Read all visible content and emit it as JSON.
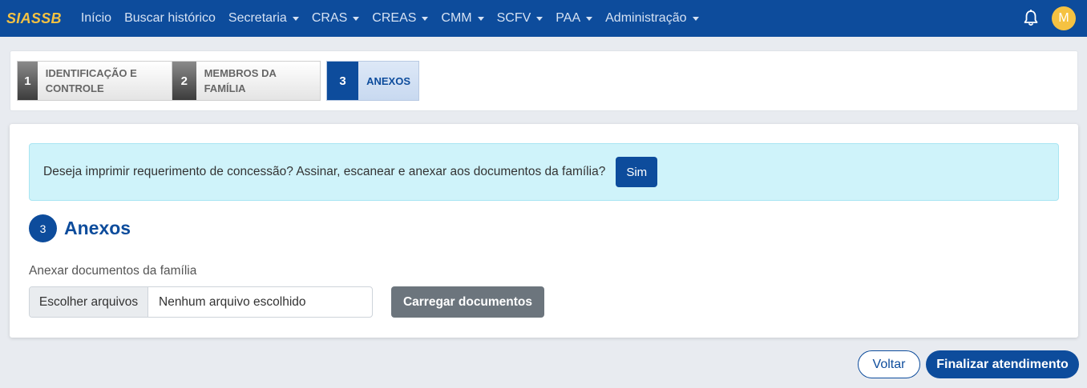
{
  "navbar": {
    "brand": "SIASSB",
    "items": [
      {
        "label": "Início",
        "dropdown": false
      },
      {
        "label": "Buscar histórico",
        "dropdown": false
      },
      {
        "label": "Secretaria",
        "dropdown": true
      },
      {
        "label": "CRAS",
        "dropdown": true
      },
      {
        "label": "CREAS",
        "dropdown": true
      },
      {
        "label": "CMM",
        "dropdown": true
      },
      {
        "label": "SCFV",
        "dropdown": true
      },
      {
        "label": "PAA",
        "dropdown": true
      },
      {
        "label": "Administração",
        "dropdown": true
      }
    ],
    "notification_icon": "bell-icon",
    "avatar_initial": "M"
  },
  "steps": [
    {
      "number": "1",
      "label": "IDENTIFICAÇÃO E CONTROLE",
      "active": false
    },
    {
      "number": "2",
      "label": "MEMBROS DA FAMÍLIA",
      "active": false
    },
    {
      "number": "3",
      "label": "ANEXOS",
      "active": true
    }
  ],
  "alert": {
    "text": "Deseja imprimir requerimento de concessão? Assinar, escanear e anexar aos documentos da família?",
    "button_label": "Sim"
  },
  "section": {
    "number": "3",
    "title": "Anexos"
  },
  "attachments": {
    "label": "Anexar documentos da família",
    "choose_button": "Escolher arquivos",
    "no_file_text": "Nenhum arquivo escolhido",
    "upload_button": "Carregar documentos"
  },
  "footer": {
    "back_label": "Voltar",
    "finish_label": "Finalizar atendimento"
  },
  "colors": {
    "primary": "#0d4c9c",
    "brand_accent": "#f5c242",
    "alert_bg": "#cff3fa",
    "secondary_button": "#6c757d"
  }
}
